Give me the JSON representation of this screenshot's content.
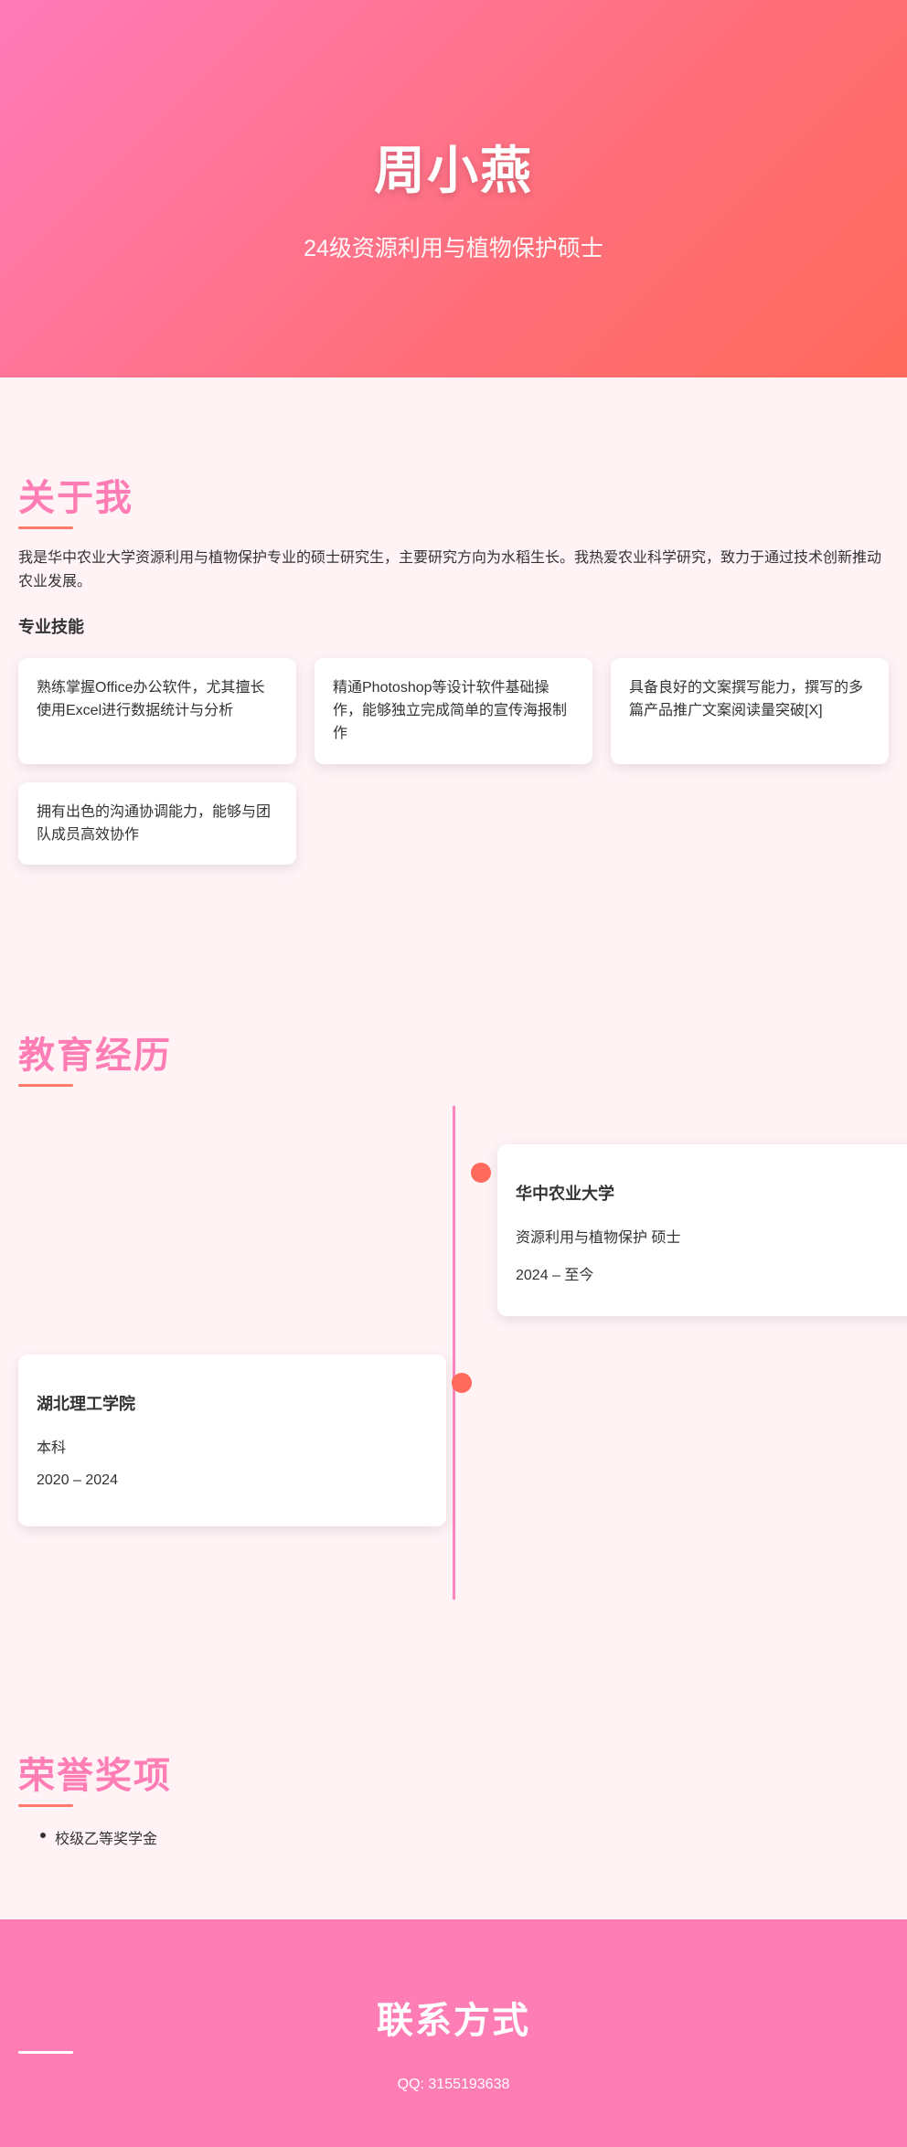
{
  "hero": {
    "name": "周小燕",
    "subtitle": "24级资源利用与植物保护硕士"
  },
  "about": {
    "title": "关于我",
    "text": "我是华中农业大学资源利用与植物保护专业的硕士研究生，主要研究方向为水稻生长。我热爱农业科学研究，致力于通过技术创新推动农业发展。",
    "skills_heading": "专业技能",
    "skills": [
      "熟练掌握Office办公软件，尤其擅长使用Excel进行数据统计与分析",
      "精通Photoshop等设计软件基础操作，能够独立完成简单的宣传海报制作",
      "具备良好的文案撰写能力，撰写的多篇产品推广文案阅读量突破[X]",
      "拥有出色的沟通协调能力，能够与团队成员高效协作"
    ]
  },
  "education": {
    "title": "教育经历",
    "items": [
      {
        "school": "华中农业大学",
        "degree": "资源利用与植物保护 硕士",
        "period": "2024 – 至今"
      },
      {
        "school": "湖北理工学院",
        "degree": "本科",
        "period": "2020 – 2024"
      }
    ]
  },
  "honors": {
    "title": "荣誉奖项",
    "items": [
      "校级乙等奖学金"
    ]
  },
  "contact": {
    "title": "联系方式",
    "qq": "QQ: 3155193638"
  },
  "colors": {
    "accent_pink": "#ff7db5",
    "accent_coral": "#ff6a5c",
    "page_bg": "#fff3f6"
  }
}
